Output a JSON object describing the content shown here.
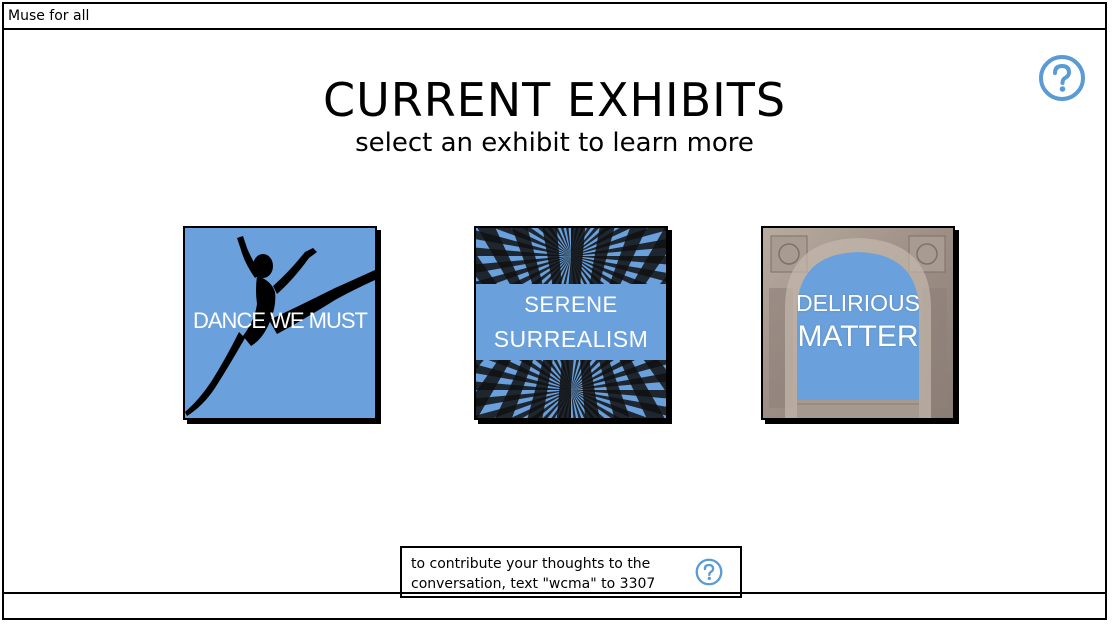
{
  "window": {
    "title": "Muse for all"
  },
  "header": {
    "heading": "CURRENT EXHIBITS",
    "subheading": "select an exhibit to learn more"
  },
  "exhibits": [
    {
      "label_lines": [
        "DANCE WE MUST"
      ],
      "image": "dancer-silhouette"
    },
    {
      "label_lines": [
        "SERENE",
        "SURREALISM"
      ],
      "image": "op-art-radial-pattern"
    },
    {
      "label_lines": [
        "DELIRIOUS",
        "MATTER"
      ],
      "image": "stone-archway"
    }
  ],
  "footer_tip": {
    "line1": "to contribute your thoughts to the",
    "line2": "conversation, text \"wcma\" to 3307"
  },
  "icons": {
    "help_top": "help-circle-icon",
    "help_tip": "help-circle-icon"
  },
  "colors": {
    "accent": "#6aa0db",
    "icon_blue": "#5b9bd5",
    "border": "#000000",
    "background": "#ffffff"
  }
}
